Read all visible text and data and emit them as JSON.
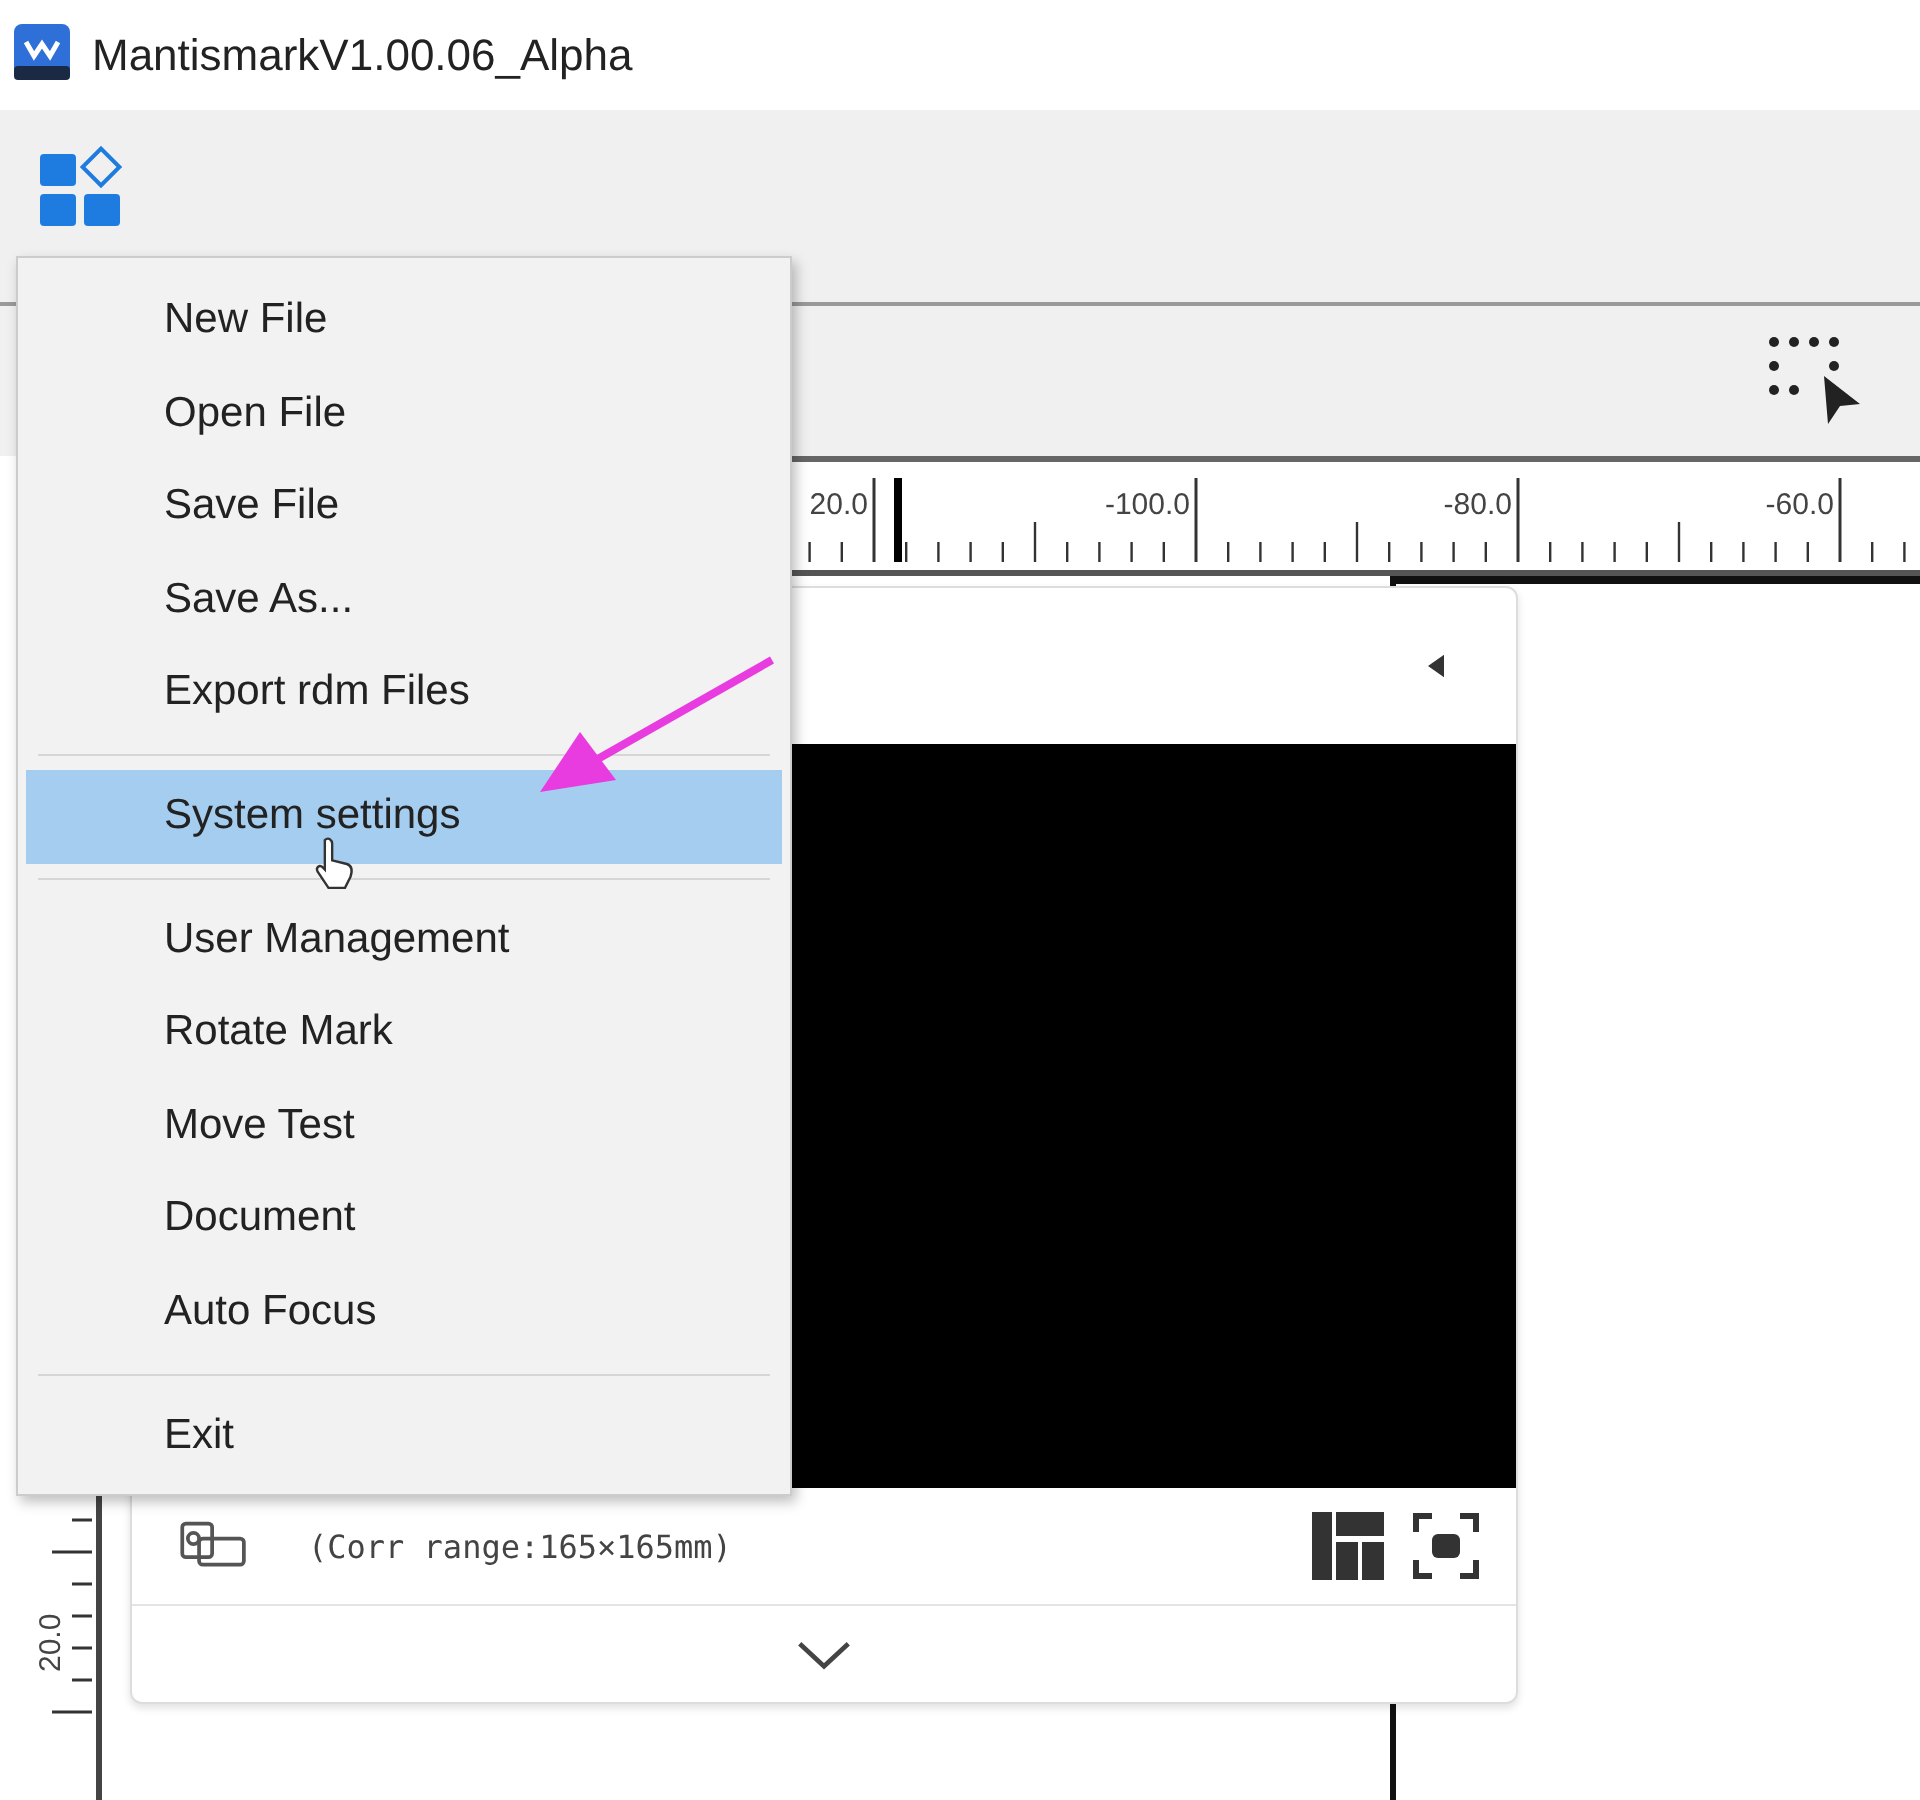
{
  "window": {
    "title": "MantismarkV1.00.06_Alpha"
  },
  "menu": {
    "groups": [
      [
        {
          "label": "New File",
          "selected": false
        },
        {
          "label": "Open File",
          "selected": false
        },
        {
          "label": "Save File",
          "selected": false
        },
        {
          "label": "Save As...",
          "selected": false
        },
        {
          "label": "Export rdm Files",
          "selected": false
        }
      ],
      [
        {
          "label": "System settings",
          "selected": true
        }
      ],
      [
        {
          "label": "User Management",
          "selected": false
        },
        {
          "label": "Rotate Mark",
          "selected": false
        },
        {
          "label": "Move Test",
          "selected": false
        },
        {
          "label": "Document",
          "selected": false
        },
        {
          "label": "Auto Focus",
          "selected": false
        }
      ],
      [
        {
          "label": "Exit",
          "selected": false
        }
      ]
    ]
  },
  "ruler": {
    "horizontal_labels": [
      "20.0",
      "-100.0",
      "-80.0",
      "-60.0"
    ],
    "vertical_labels": [
      "20.0"
    ]
  },
  "camera_panel": {
    "range_text": "(Corr range:165×165mm)"
  }
}
